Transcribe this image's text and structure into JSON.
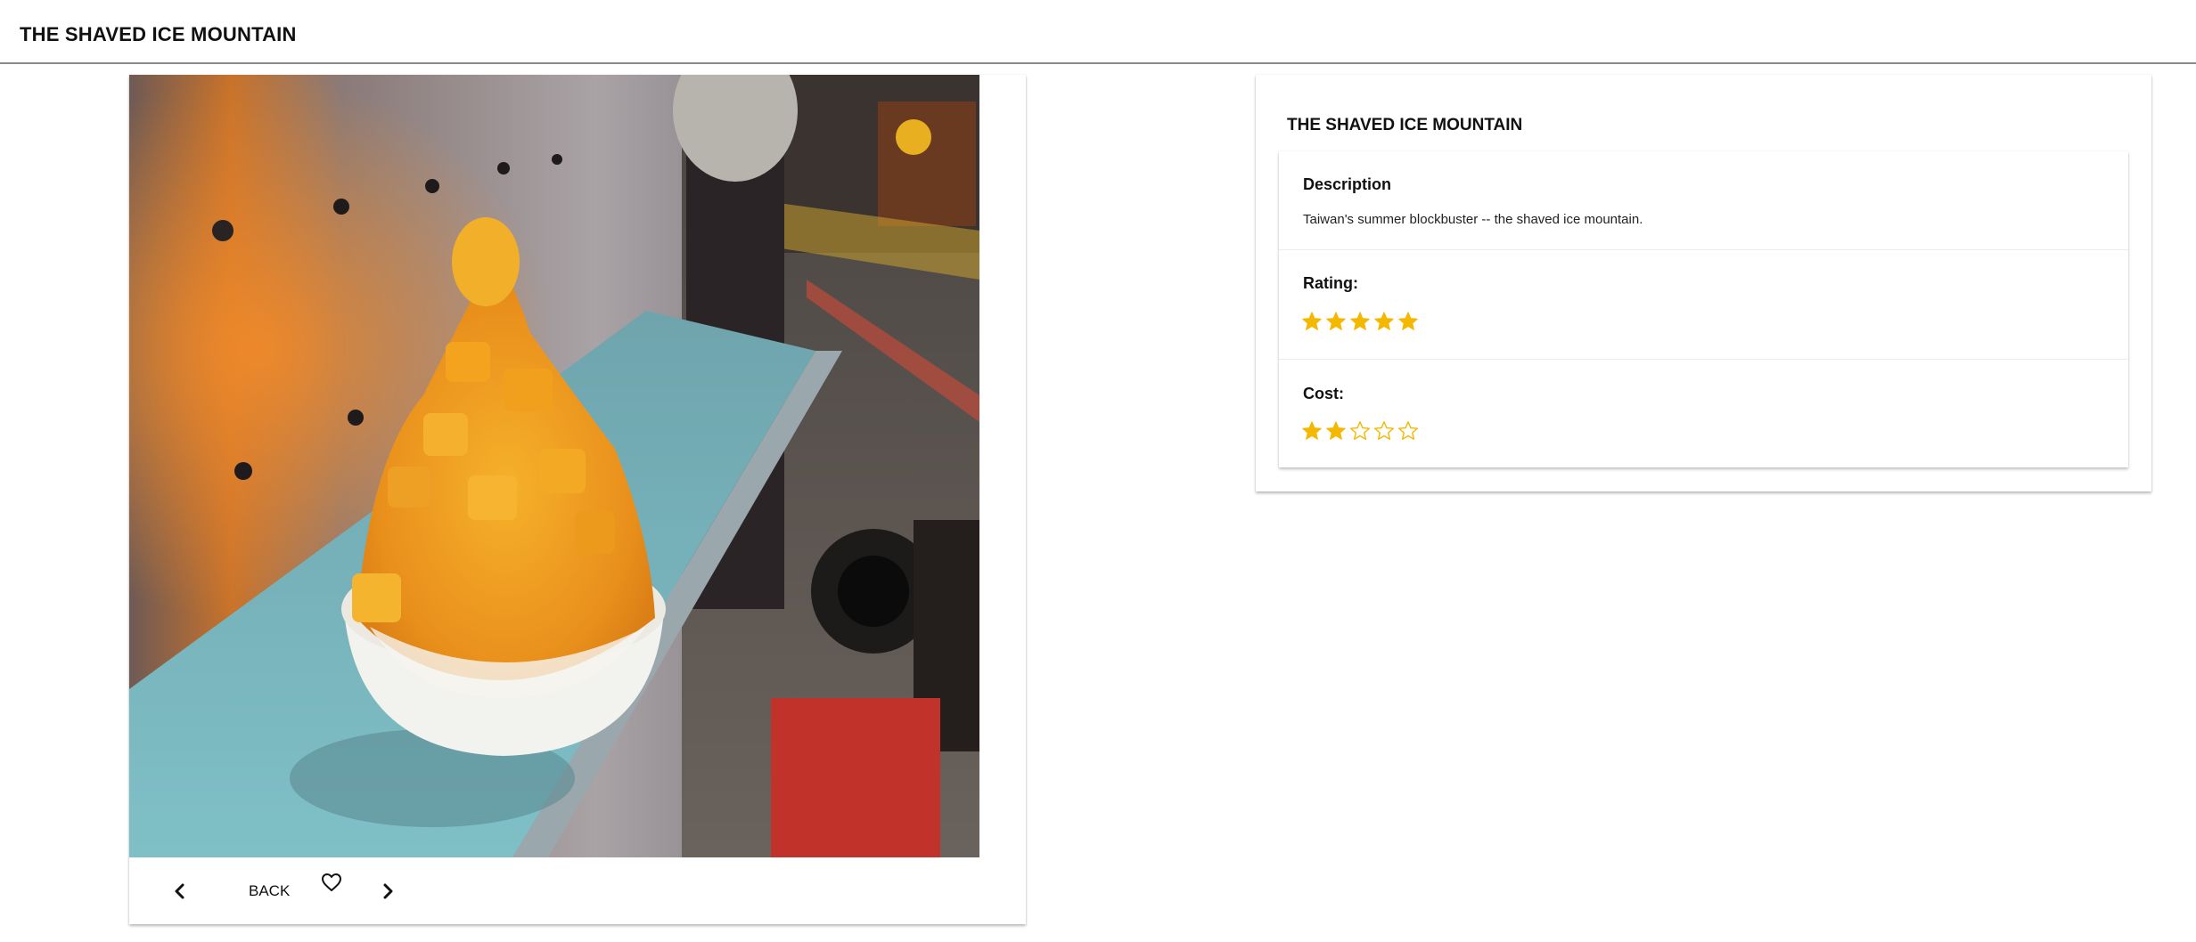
{
  "header": {
    "title": "THE SHAVED ICE MOUNTAIN"
  },
  "photo_card": {
    "image_icon": "photo-shaved-ice",
    "actions": {
      "prev_icon": "chevron-left-icon",
      "back_label": "BACK",
      "favorite_icon": "heart-outline-icon",
      "next_icon": "chevron-right-icon"
    }
  },
  "details": {
    "title": "THE SHAVED ICE MOUNTAIN",
    "description": {
      "label": "Description",
      "text": "Taiwan's summer blockbuster -- the shaved ice mountain."
    },
    "rating": {
      "label": "Rating:",
      "value": 5,
      "max": 5
    },
    "cost": {
      "label": "Cost:",
      "value": 2,
      "max": 5
    }
  },
  "colors": {
    "star": "#f5b800",
    "divider": "#8a8a8a",
    "text": "#111111"
  }
}
